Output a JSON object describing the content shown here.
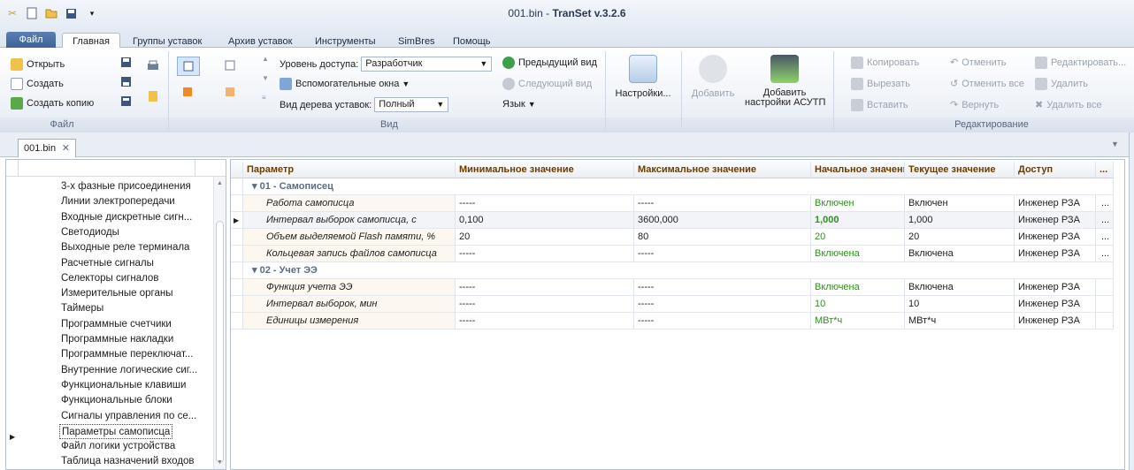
{
  "window": {
    "title_file": "001.bin",
    "title_sep": " - ",
    "title_app": "TranSet v.3.2.6"
  },
  "ribbon_tabs": [
    "Файл",
    "Главная",
    "Группы уставок",
    "Архив уставок",
    "Инструменты",
    "SimBres",
    "Помощь"
  ],
  "file_group": {
    "open": "Открыть",
    "create": "Создать",
    "create_copy": "Создать копию",
    "label": "Файл"
  },
  "view_group": {
    "access_label": "Уровень доступа:",
    "access_value": "Разработчик",
    "aux_windows": "Вспомогательные окна",
    "tree_label": "Вид дерева уставок:",
    "tree_value": "Полный",
    "prev_view": "Предыдущий вид",
    "next_view": "Следующий вид",
    "language": "Язык",
    "label": "Вид"
  },
  "settings_btn": "Настройки...",
  "add_btn": "Добавить",
  "add_asutp_line1": "Добавить",
  "add_asutp_line2": "настройки АСУТП",
  "edit_group": {
    "copy": "Копировать",
    "cut": "Вырезать",
    "paste": "Вставить",
    "undo": "Отменить",
    "undo_all": "Отменить все",
    "redo": "Вернуть",
    "edit": "Редактировать...",
    "delete": "Удалить",
    "delete_all": "Удалить все",
    "label": "Редактирование"
  },
  "doc_tab": "001.bin",
  "tree_items": [
    "3-х фазные присоединения",
    "Линии электропередачи",
    "Входные дискретные сигн...",
    "Светодиоды",
    "Выходные реле терминала",
    "Расчетные сигналы",
    "Селекторы сигналов",
    "Измерительные органы",
    "Таймеры",
    "Программные счетчики",
    "Программные накладки",
    "Программные переключат...",
    "Внутренние логические сиг...",
    "Функциональные клавиши",
    "Функциональные блоки",
    "Сигналы управления по се...",
    "Параметры самописца",
    "Файл логики устройства",
    "Таблица назначений входов"
  ],
  "tree_selected": "Параметры самописца",
  "grid": {
    "headers": [
      "Параметр",
      "Минимальное значение",
      "Максимальное значение",
      "Начальное значение",
      "Текущее значение",
      "Доступ",
      "..."
    ],
    "groups": [
      {
        "name": "01 - Самописец",
        "rows": [
          [
            "Работа самописца",
            "-----",
            "-----",
            "Включен",
            "Включен",
            "Инженер РЗА",
            "..."
          ],
          [
            "Интервал выборок самописца, с",
            "0,100",
            "3600,000",
            "1,000",
            "1,000",
            "Инженер РЗА",
            "..."
          ],
          [
            "Объем выделяемой Flash памяти, %",
            "20",
            "80",
            "20",
            "20",
            "Инженер РЗА",
            "..."
          ],
          [
            "Кольцевая запись файлов самописца",
            "-----",
            "-----",
            "Включена",
            "Включена",
            "Инженер РЗА",
            "..."
          ]
        ]
      },
      {
        "name": "02 - Учет ЭЭ",
        "rows": [
          [
            "Функция учета ЭЭ",
            "-----",
            "-----",
            "Включена",
            "Включена",
            "Инженер РЗА",
            ""
          ],
          [
            "Интервал выборок, мин",
            "-----",
            "-----",
            "10",
            "10",
            "Инженер РЗА",
            ""
          ],
          [
            "Единицы измерения",
            "-----",
            "-----",
            "МВт*ч",
            "МВт*ч",
            "Инженер РЗА",
            ""
          ]
        ]
      }
    ]
  },
  "colors": {
    "accent": "#3d6298",
    "green_value": "#2f8f1f",
    "header_text": "#6a3c00"
  }
}
